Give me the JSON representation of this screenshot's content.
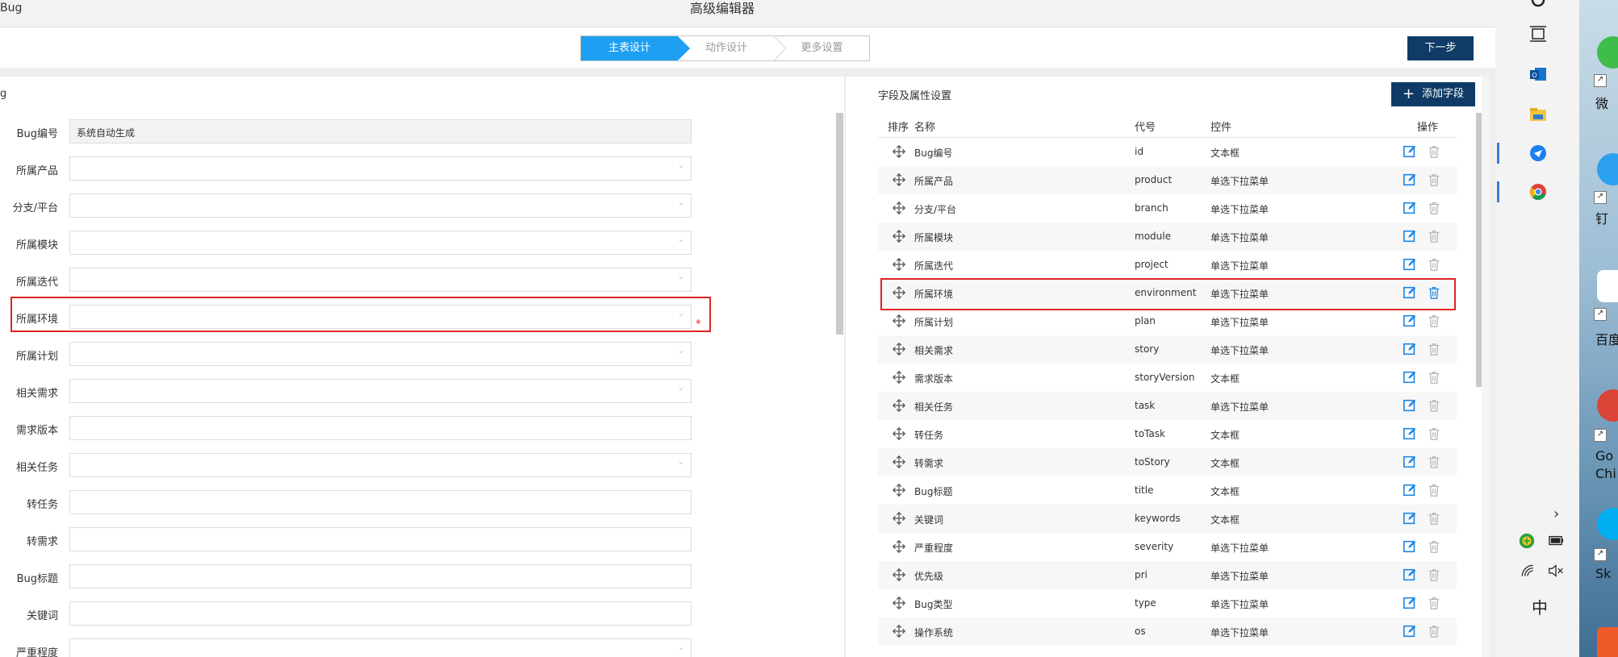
{
  "window": {
    "left_title": "Bug",
    "title": "高级编辑器"
  },
  "steps": [
    "主表设计",
    "动作设计",
    "更多设置"
  ],
  "next_button": "下一步",
  "form": {
    "title": "g",
    "fields": [
      {
        "label": "Bug编号",
        "value": "系统自动生成",
        "type": "readonly"
      },
      {
        "label": "所属产品",
        "value": "",
        "type": "select"
      },
      {
        "label": "分支/平台",
        "value": "",
        "type": "select"
      },
      {
        "label": "所属模块",
        "value": "",
        "type": "select"
      },
      {
        "label": "所属迭代",
        "value": "",
        "type": "select"
      },
      {
        "label": "所属环境",
        "value": "",
        "type": "select",
        "required": "*"
      },
      {
        "label": "所属计划",
        "value": "",
        "type": "select"
      },
      {
        "label": "相关需求",
        "value": "",
        "type": "select"
      },
      {
        "label": "需求版本",
        "value": "",
        "type": "text"
      },
      {
        "label": "相关任务",
        "value": "",
        "type": "select"
      },
      {
        "label": "转任务",
        "value": "",
        "type": "text"
      },
      {
        "label": "转需求",
        "value": "",
        "type": "text"
      },
      {
        "label": "Bug标题",
        "value": "",
        "type": "text"
      },
      {
        "label": "关键词",
        "value": "",
        "type": "text"
      },
      {
        "label": "严重程度",
        "value": "",
        "type": "select"
      }
    ]
  },
  "fields_panel": {
    "title": "字段及属性设置",
    "add_button": "添加字段",
    "columns": [
      "排序",
      "名称",
      "代号",
      "控件",
      "操作"
    ],
    "rows": [
      {
        "name": "Bug编号",
        "code": "id",
        "control": "文本框"
      },
      {
        "name": "所属产品",
        "code": "product",
        "control": "单选下拉菜单"
      },
      {
        "name": "分支/平台",
        "code": "branch",
        "control": "单选下拉菜单"
      },
      {
        "name": "所属模块",
        "code": "module",
        "control": "单选下拉菜单"
      },
      {
        "name": "所属迭代",
        "code": "project",
        "control": "单选下拉菜单"
      },
      {
        "name": "所属环境",
        "code": "environment",
        "control": "单选下拉菜单"
      },
      {
        "name": "所属计划",
        "code": "plan",
        "control": "单选下拉菜单"
      },
      {
        "name": "相关需求",
        "code": "story",
        "control": "单选下拉菜单"
      },
      {
        "name": "需求版本",
        "code": "storyVersion",
        "control": "文本框"
      },
      {
        "name": "相关任务",
        "code": "task",
        "control": "单选下拉菜单"
      },
      {
        "name": "转任务",
        "code": "toTask",
        "control": "文本框"
      },
      {
        "name": "转需求",
        "code": "toStory",
        "control": "文本框"
      },
      {
        "name": "Bug标题",
        "code": "title",
        "control": "文本框"
      },
      {
        "name": "关键词",
        "code": "keywords",
        "control": "文本框"
      },
      {
        "name": "严重程度",
        "code": "severity",
        "control": "单选下拉菜单"
      },
      {
        "name": "优先级",
        "code": "pri",
        "control": "单选下拉菜单"
      },
      {
        "name": "Bug类型",
        "code": "type",
        "control": "单选下拉菜单"
      },
      {
        "name": "操作系统",
        "code": "os",
        "control": "单选下拉菜单"
      }
    ]
  },
  "taskbar": {
    "ime": "中"
  },
  "desktop": {
    "labels": [
      "微",
      "钉",
      "百度",
      "Go",
      "Chi",
      "Sk"
    ]
  },
  "colors": {
    "primary": "#0f3b66",
    "step_active": "#1e9ff2",
    "highlight": "#e02424",
    "edit_icon": "#1e88e5",
    "delete_icon": "#b8b8b8"
  }
}
